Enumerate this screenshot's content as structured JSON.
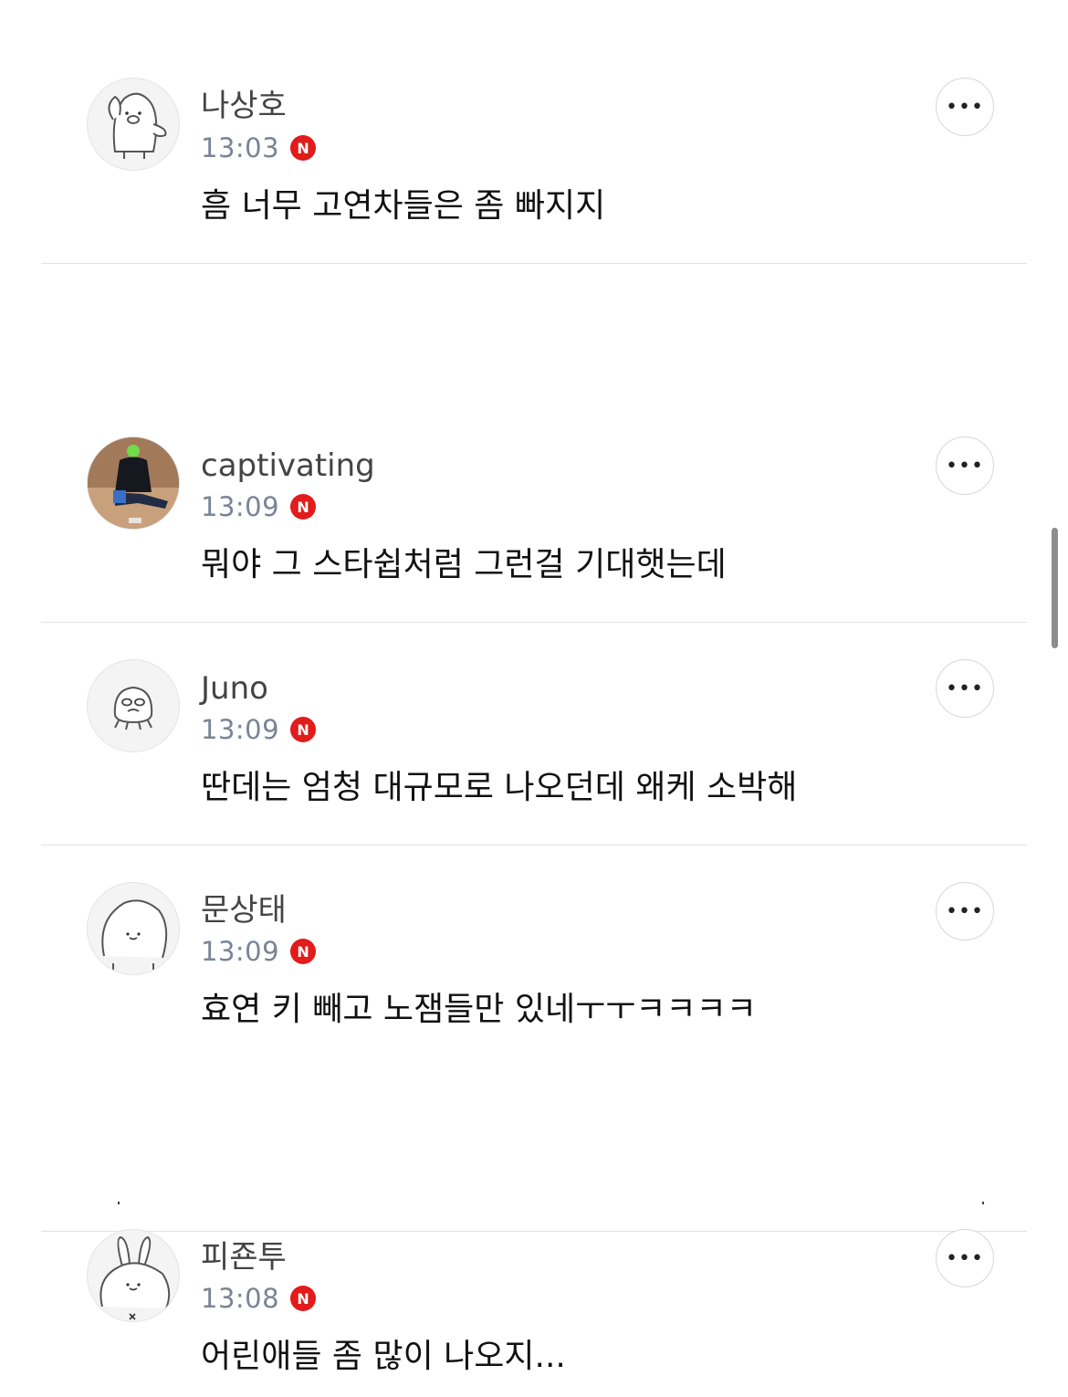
{
  "comments": [
    {
      "name": "나상호",
      "time": "13:03",
      "badge": "N",
      "text": "흠  너무 고연차들은 좀 빠지지",
      "avatar_icon": "penguin-avatar-icon"
    },
    {
      "name": "captivating",
      "time": "13:09",
      "badge": "N",
      "text": "뭐야 그 스타쉽처럼 그런걸 기대햇는데",
      "avatar_icon": "photo-avatar"
    },
    {
      "name": "Juno",
      "time": "13:09",
      "badge": "N",
      "text": "딴데는 엄청 대규모로 나오던데 왜케 소박해",
      "avatar_icon": "octopus-avatar-icon"
    },
    {
      "name": "문상태",
      "time": "13:09",
      "badge": "N",
      "text": "효연 키 빼고 노잼들만 있네ㅜㅜㅋㅋㅋㅋ",
      "avatar_icon": "blob-avatar-icon"
    },
    {
      "name": "피죤투",
      "time": "13:08",
      "badge": "N",
      "text": "어린애들 좀 많이 나오지...",
      "avatar_icon": "rabbit-avatar-icon"
    }
  ],
  "more_label": "•••",
  "colors": {
    "badge": "#e21b1b",
    "time": "#7a8496",
    "divider": "#e2e2e2"
  }
}
